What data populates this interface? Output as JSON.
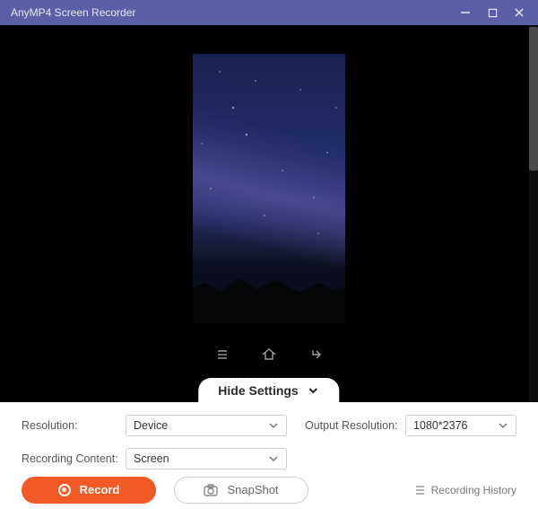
{
  "titlebar": {
    "title": "AnyMP4 Screen Recorder"
  },
  "toggle": {
    "label": "Hide Settings"
  },
  "settings": {
    "resolution_label": "Resolution:",
    "resolution_value": "Device",
    "output_label": "Output Resolution:",
    "output_value": "1080*2376",
    "content_label": "Recording Content:",
    "content_value": "Screen"
  },
  "footer": {
    "record": "Record",
    "snapshot": "SnapShot",
    "history": "Recording History"
  }
}
